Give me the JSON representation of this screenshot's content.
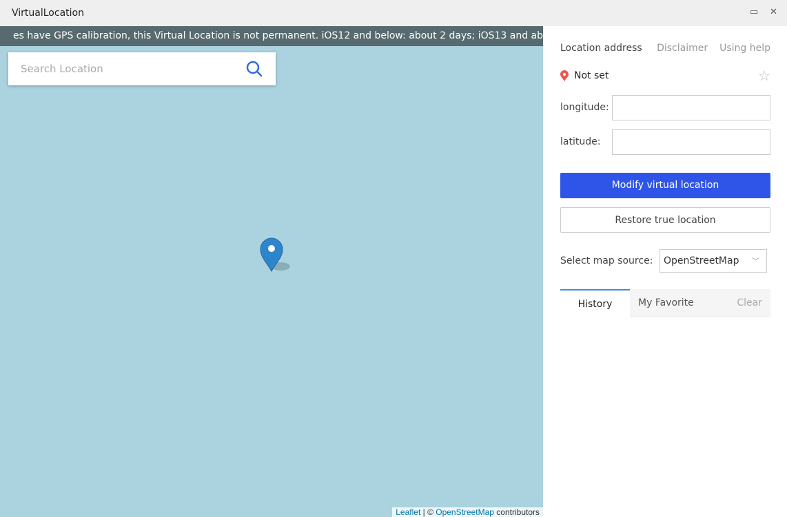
{
  "window": {
    "title": "VirtualLocation",
    "maximize_icon": "maximize-icon",
    "close_icon": "close-icon"
  },
  "map": {
    "banner": "es have GPS calibration, this Virtual Location is not permanent. iOS12 and below: about 2 days; iOS13 and above: ab",
    "search_placeholder": "Search Location",
    "attribution": {
      "leaflet": "Leaflet",
      "sep": " | © ",
      "osm": "OpenStreetMap",
      "contributors": " contributors"
    }
  },
  "panel": {
    "location_address": "Location address",
    "disclaimer": "Disclaimer",
    "using_help": "Using help",
    "status": "Not set",
    "longitude_label": "longitude:",
    "latitude_label": "latitude:",
    "longitude_value": "",
    "latitude_value": "",
    "modify_button": "Modify virtual location",
    "restore_button": "Restore true location",
    "map_source_label": "Select map source:",
    "map_source_value": "OpenStreetMap",
    "tabs": [
      "History",
      "My Favorite"
    ],
    "clear": "Clear"
  }
}
